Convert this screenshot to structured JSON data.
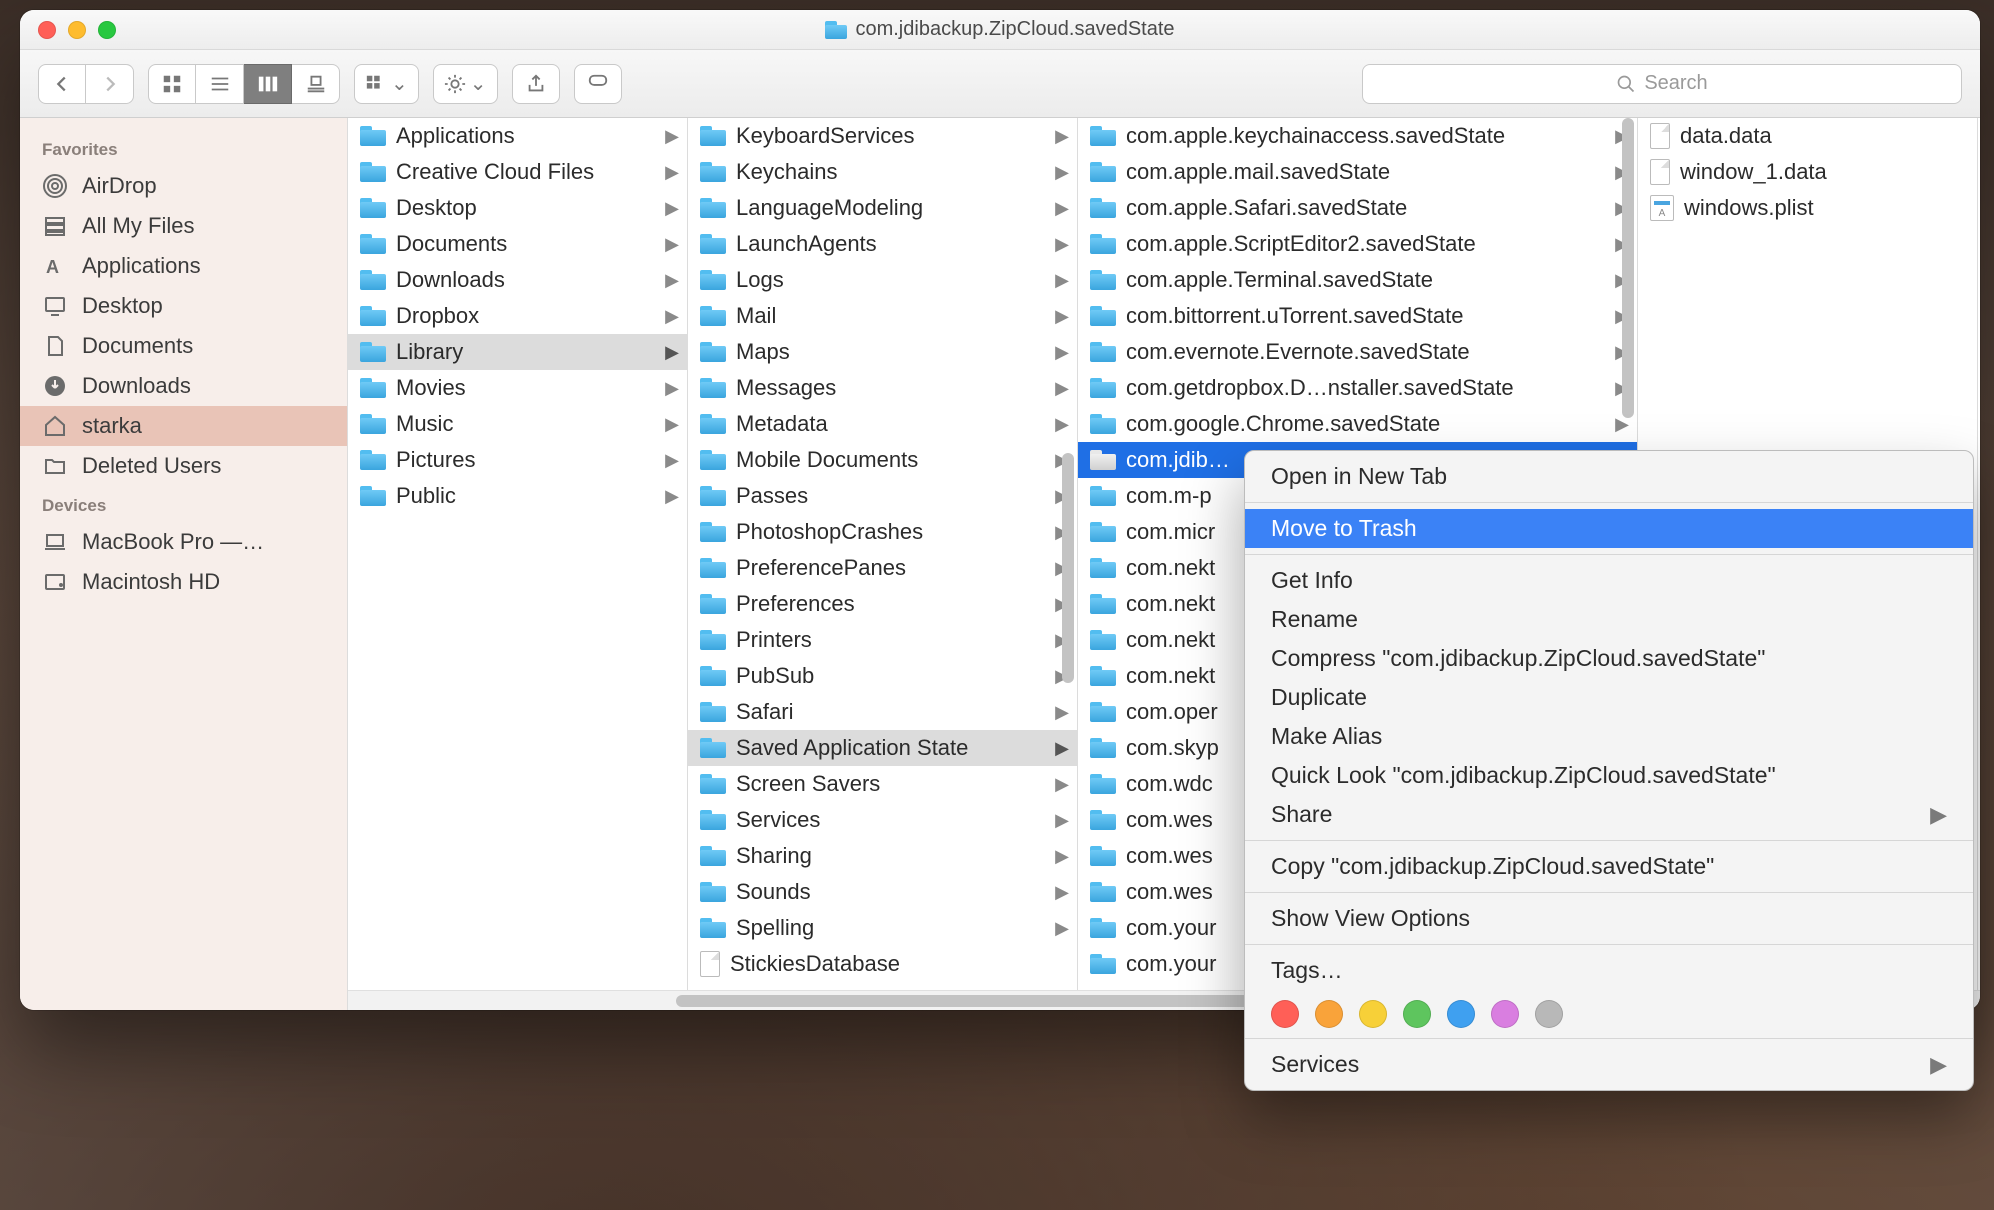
{
  "window": {
    "title": "com.jdibackup.ZipCloud.savedState"
  },
  "toolbar": {
    "search_placeholder": "Search"
  },
  "sidebar": {
    "favorites_header": "Favorites",
    "devices_header": "Devices",
    "favorites": [
      {
        "label": "AirDrop",
        "icon": "airdrop"
      },
      {
        "label": "All My Files",
        "icon": "allfiles"
      },
      {
        "label": "Applications",
        "icon": "apps"
      },
      {
        "label": "Desktop",
        "icon": "desktop"
      },
      {
        "label": "Documents",
        "icon": "documents"
      },
      {
        "label": "Downloads",
        "icon": "downloads"
      },
      {
        "label": "starka",
        "icon": "home",
        "selected": true
      },
      {
        "label": "Deleted Users",
        "icon": "folder"
      }
    ],
    "devices": [
      {
        "label": "MacBook Pro —…",
        "icon": "laptop"
      },
      {
        "label": "Macintosh HD",
        "icon": "disk"
      }
    ]
  },
  "columns": {
    "c1": [
      {
        "label": "Applications"
      },
      {
        "label": "Creative Cloud Files"
      },
      {
        "label": "Desktop"
      },
      {
        "label": "Documents"
      },
      {
        "label": "Downloads"
      },
      {
        "label": "Dropbox"
      },
      {
        "label": "Library",
        "selected": true
      },
      {
        "label": "Movies"
      },
      {
        "label": "Music"
      },
      {
        "label": "Pictures"
      },
      {
        "label": "Public"
      }
    ],
    "c2": [
      {
        "label": "KeyboardServices"
      },
      {
        "label": "Keychains"
      },
      {
        "label": "LanguageModeling"
      },
      {
        "label": "LaunchAgents"
      },
      {
        "label": "Logs"
      },
      {
        "label": "Mail"
      },
      {
        "label": "Maps"
      },
      {
        "label": "Messages"
      },
      {
        "label": "Metadata"
      },
      {
        "label": "Mobile Documents"
      },
      {
        "label": "Passes"
      },
      {
        "label": "PhotoshopCrashes"
      },
      {
        "label": "PreferencePanes"
      },
      {
        "label": "Preferences"
      },
      {
        "label": "Printers"
      },
      {
        "label": "PubSub"
      },
      {
        "label": "Safari"
      },
      {
        "label": "Saved Application State",
        "selected": true
      },
      {
        "label": "Screen Savers"
      },
      {
        "label": "Services"
      },
      {
        "label": "Sharing"
      },
      {
        "label": "Sounds"
      },
      {
        "label": "Spelling"
      },
      {
        "label": "StickiesDatabase",
        "file": true
      }
    ],
    "c3": [
      {
        "label": "com.apple.keychainaccess.savedState"
      },
      {
        "label": "com.apple.mail.savedState"
      },
      {
        "label": "com.apple.Safari.savedState"
      },
      {
        "label": "com.apple.ScriptEditor2.savedState"
      },
      {
        "label": "com.apple.Terminal.savedState"
      },
      {
        "label": "com.bittorrent.uTorrent.savedState"
      },
      {
        "label": "com.evernote.Evernote.savedState"
      },
      {
        "label": "com.getdropbox.D…nstaller.savedState"
      },
      {
        "label": "com.google.Chrome.savedState"
      },
      {
        "label": "com.jdib…",
        "selected": true
      },
      {
        "label": "com.m-p"
      },
      {
        "label": "com.micr"
      },
      {
        "label": "com.nekt"
      },
      {
        "label": "com.nekt"
      },
      {
        "label": "com.nekt"
      },
      {
        "label": "com.nekt"
      },
      {
        "label": "com.oper"
      },
      {
        "label": "com.skyp"
      },
      {
        "label": "com.wdc"
      },
      {
        "label": "com.wes"
      },
      {
        "label": "com.wes"
      },
      {
        "label": "com.wes"
      },
      {
        "label": "com.your"
      },
      {
        "label": "com.your"
      }
    ],
    "c4": [
      {
        "label": "data.data",
        "type": "file"
      },
      {
        "label": "window_1.data",
        "type": "file"
      },
      {
        "label": "windows.plist",
        "type": "plist"
      }
    ]
  },
  "context_menu": {
    "open_tab": "Open in New Tab",
    "move_trash": "Move to Trash",
    "get_info": "Get Info",
    "rename": "Rename",
    "compress": "Compress \"com.jdibackup.ZipCloud.savedState\"",
    "duplicate": "Duplicate",
    "make_alias": "Make Alias",
    "quick_look": "Quick Look \"com.jdibackup.ZipCloud.savedState\"",
    "share": "Share",
    "copy": "Copy \"com.jdibackup.ZipCloud.savedState\"",
    "view_options": "Show View Options",
    "tags": "Tags…",
    "services": "Services",
    "tag_colors": [
      "#ff5f57",
      "#f9a33a",
      "#f7d038",
      "#5ec55e",
      "#3fa0f0",
      "#d97ee0",
      "#b8b8b8"
    ]
  }
}
